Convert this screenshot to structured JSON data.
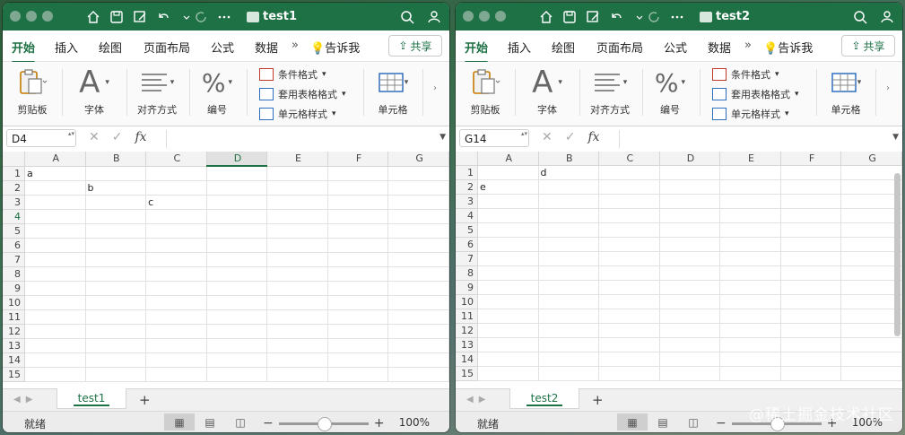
{
  "accent": "#1e7145",
  "windows": [
    {
      "title": "test1",
      "tabs": [
        "开始",
        "插入",
        "绘图",
        "页面布局",
        "公式",
        "数据",
        "告诉我"
      ],
      "share_label": "共享",
      "ribbon": {
        "clipboard": "剪贴板",
        "font": "字体",
        "alignment": "对齐方式",
        "number": "编号",
        "cond_format": "条件格式",
        "table_format": "套用表格格式",
        "cell_styles": "单元格样式",
        "cells": "单元格"
      },
      "namebox": "D4",
      "fx_label": "fx",
      "columns": [
        "A",
        "B",
        "C",
        "D",
        "E",
        "F",
        "G"
      ],
      "selected_col": "D",
      "selected_row": "4",
      "rows": [
        {
          "n": "1",
          "cells": [
            "a",
            "",
            "",
            "",
            "",
            "",
            ""
          ]
        },
        {
          "n": "2",
          "cells": [
            "",
            "b",
            "",
            "",
            "",
            "",
            ""
          ]
        },
        {
          "n": "3",
          "cells": [
            "",
            "",
            "c",
            "",
            "",
            "",
            ""
          ]
        },
        {
          "n": "4",
          "cells": [
            "",
            "",
            "",
            "",
            "",
            "",
            ""
          ]
        },
        {
          "n": "5",
          "cells": [
            "",
            "",
            "",
            "",
            "",
            "",
            ""
          ]
        },
        {
          "n": "6",
          "cells": [
            "",
            "",
            "",
            "",
            "",
            "",
            ""
          ]
        },
        {
          "n": "7",
          "cells": [
            "",
            "",
            "",
            "",
            "",
            "",
            ""
          ]
        },
        {
          "n": "8",
          "cells": [
            "",
            "",
            "",
            "",
            "",
            "",
            ""
          ]
        },
        {
          "n": "9",
          "cells": [
            "",
            "",
            "",
            "",
            "",
            "",
            ""
          ]
        },
        {
          "n": "10",
          "cells": [
            "",
            "",
            "",
            "",
            "",
            "",
            ""
          ]
        },
        {
          "n": "11",
          "cells": [
            "",
            "",
            "",
            "",
            "",
            "",
            ""
          ]
        },
        {
          "n": "12",
          "cells": [
            "",
            "",
            "",
            "",
            "",
            "",
            ""
          ]
        },
        {
          "n": "13",
          "cells": [
            "",
            "",
            "",
            "",
            "",
            "",
            ""
          ]
        },
        {
          "n": "14",
          "cells": [
            "",
            "",
            "",
            "",
            "",
            "",
            ""
          ]
        },
        {
          "n": "15",
          "cells": [
            "",
            "",
            "",
            "",
            "",
            "",
            ""
          ]
        }
      ],
      "sheet_tab": "test1",
      "add_sheet": "+",
      "status": "就绪",
      "zoom": "100%"
    },
    {
      "title": "test2",
      "tabs": [
        "开始",
        "插入",
        "绘图",
        "页面布局",
        "公式",
        "数据",
        "告诉我"
      ],
      "share_label": "共享",
      "ribbon": {
        "clipboard": "剪贴板",
        "font": "字体",
        "alignment": "对齐方式",
        "number": "编号",
        "cond_format": "条件格式",
        "table_format": "套用表格格式",
        "cell_styles": "单元格样式",
        "cells": "单元格"
      },
      "namebox": "G14",
      "fx_label": "fx",
      "columns": [
        "A",
        "B",
        "C",
        "D",
        "E",
        "F",
        "G"
      ],
      "selected_col": "",
      "selected_row": "",
      "rows": [
        {
          "n": "1",
          "cells": [
            "",
            "d",
            "",
            "",
            "",
            "",
            ""
          ]
        },
        {
          "n": "2",
          "cells": [
            "e",
            "",
            "",
            "",
            "",
            "",
            ""
          ]
        },
        {
          "n": "3",
          "cells": [
            "",
            "",
            "",
            "",
            "",
            "",
            ""
          ]
        },
        {
          "n": "4",
          "cells": [
            "",
            "",
            "",
            "",
            "",
            "",
            ""
          ]
        },
        {
          "n": "5",
          "cells": [
            "",
            "",
            "",
            "",
            "",
            "",
            ""
          ]
        },
        {
          "n": "6",
          "cells": [
            "",
            "",
            "",
            "",
            "",
            "",
            ""
          ]
        },
        {
          "n": "7",
          "cells": [
            "",
            "",
            "",
            "",
            "",
            "",
            ""
          ]
        },
        {
          "n": "8",
          "cells": [
            "",
            "",
            "",
            "",
            "",
            "",
            ""
          ]
        },
        {
          "n": "9",
          "cells": [
            "",
            "",
            "",
            "",
            "",
            "",
            ""
          ]
        },
        {
          "n": "10",
          "cells": [
            "",
            "",
            "",
            "",
            "",
            "",
            ""
          ]
        },
        {
          "n": "11",
          "cells": [
            "",
            "",
            "",
            "",
            "",
            "",
            ""
          ]
        },
        {
          "n": "12",
          "cells": [
            "",
            "",
            "",
            "",
            "",
            "",
            ""
          ]
        },
        {
          "n": "13",
          "cells": [
            "",
            "",
            "",
            "",
            "",
            "",
            ""
          ]
        },
        {
          "n": "14",
          "cells": [
            "",
            "",
            "",
            "",
            "",
            "",
            ""
          ]
        },
        {
          "n": "15",
          "cells": [
            "",
            "",
            "",
            "",
            "",
            "",
            ""
          ]
        }
      ],
      "sheet_tab": "test2",
      "add_sheet": "+",
      "status": "就绪",
      "zoom": "100%"
    }
  ],
  "watermark": "@稀土掘金技术社区"
}
